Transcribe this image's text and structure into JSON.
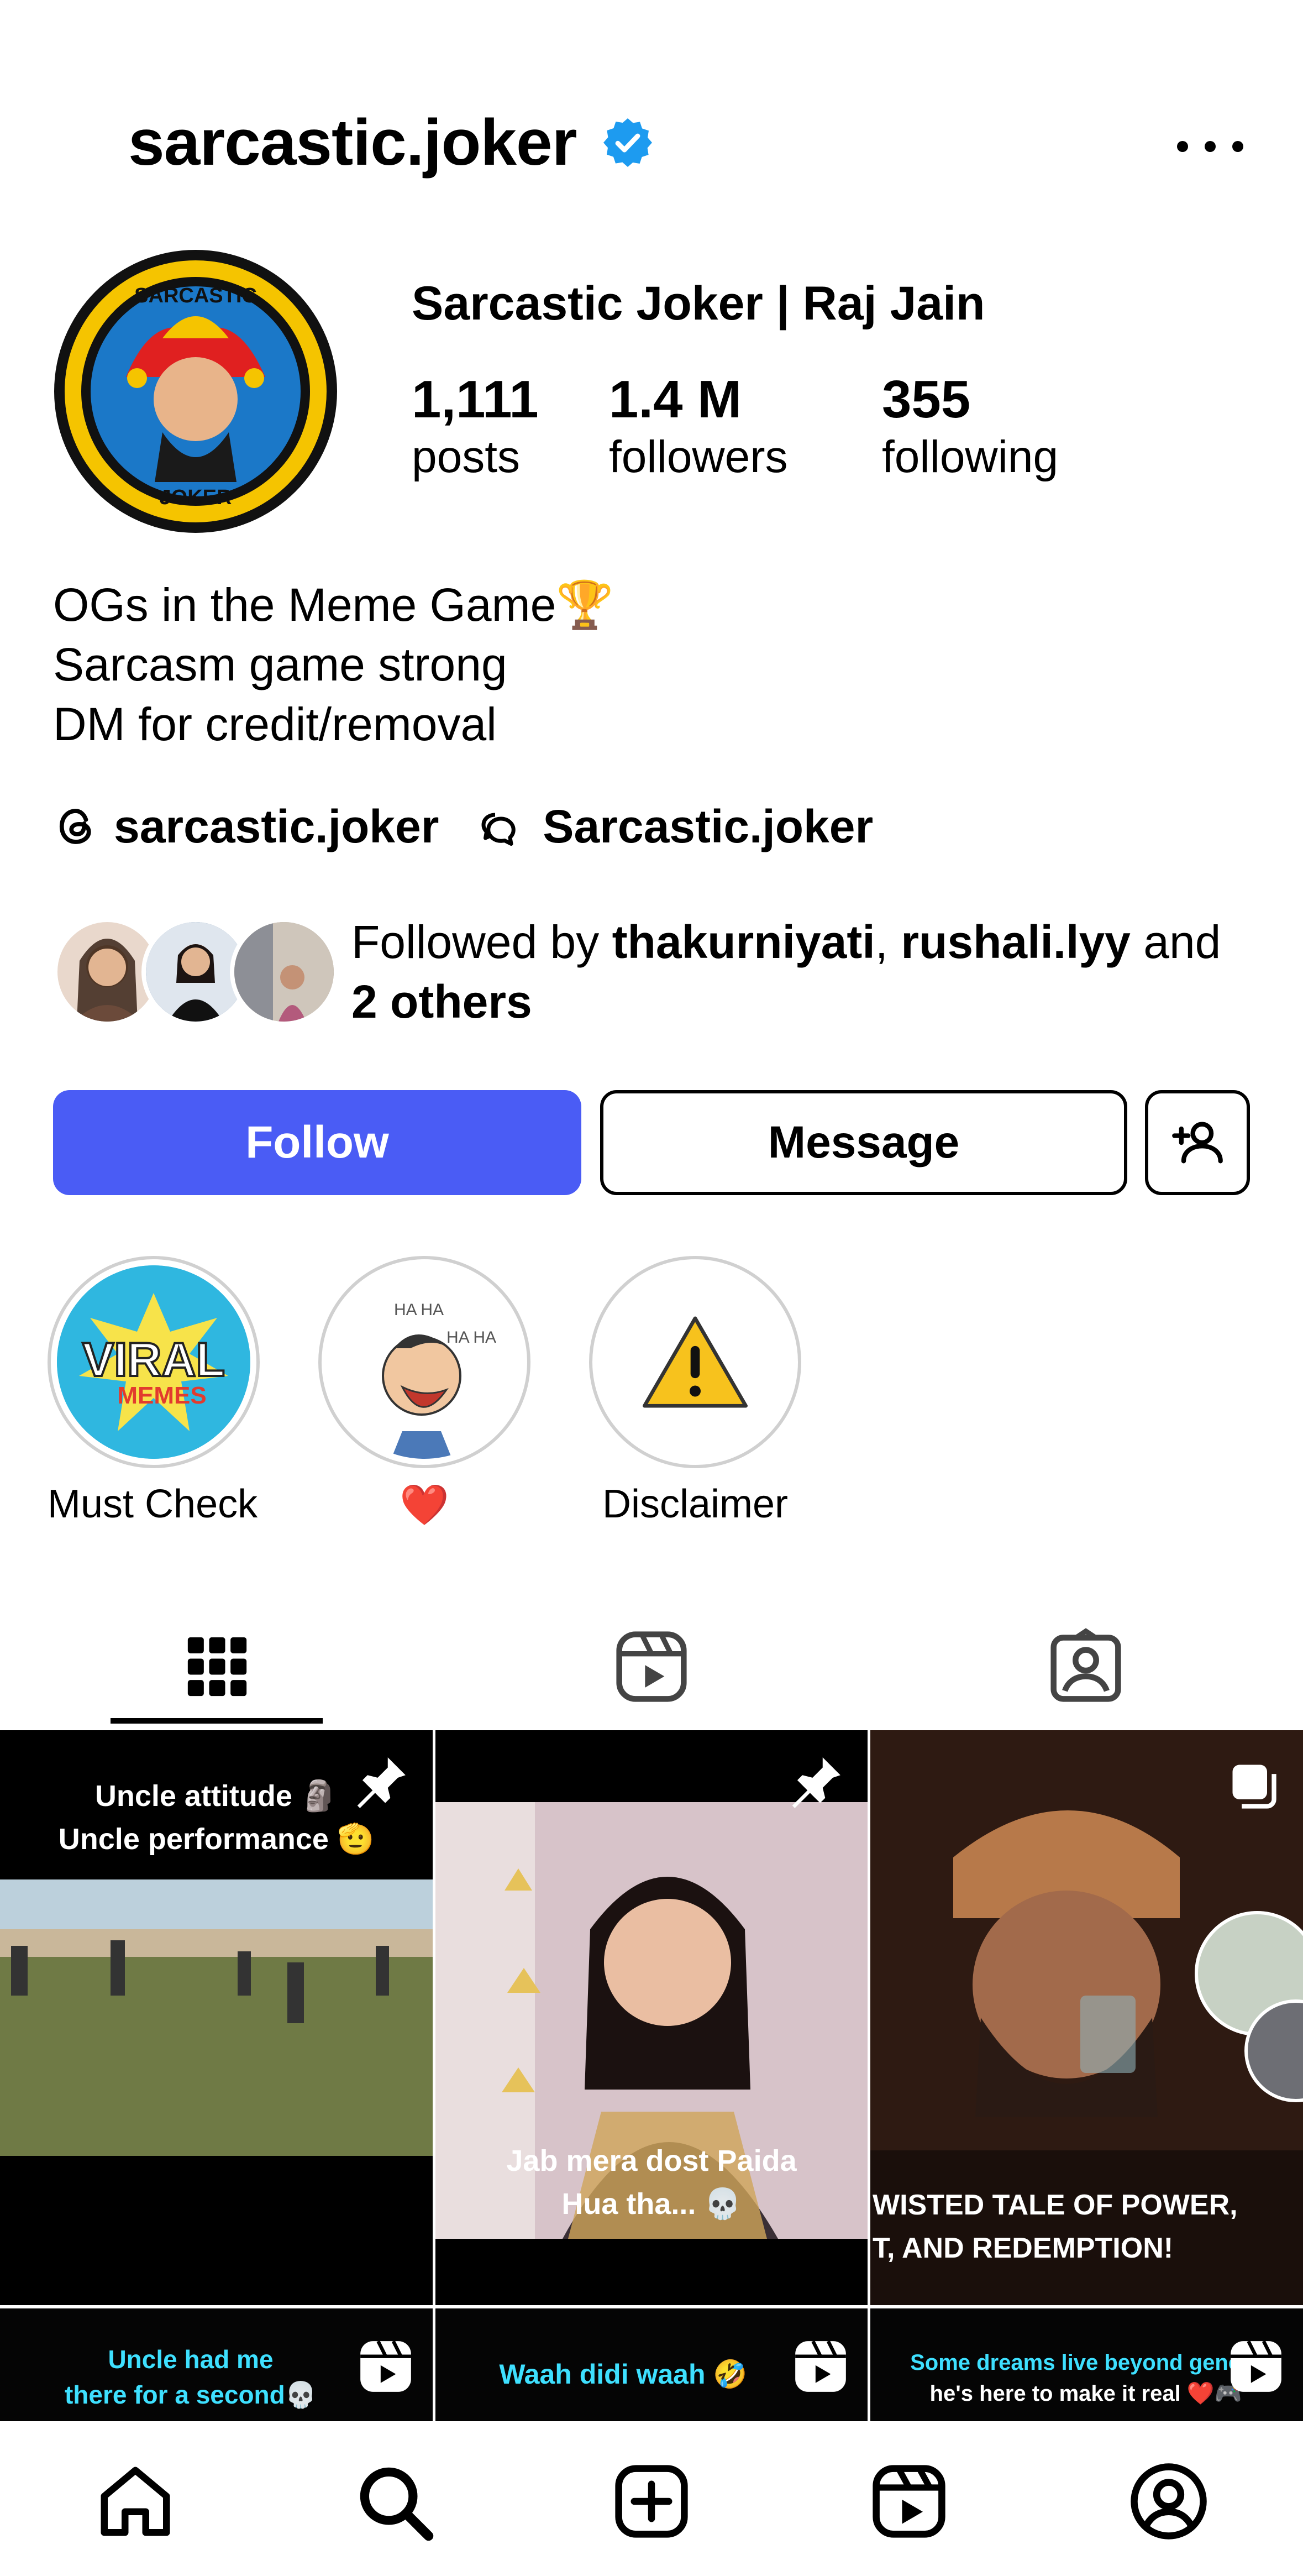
{
  "header": {
    "username": "sarcastic.joker"
  },
  "profile": {
    "display_name": "Sarcastic Joker | Raj Jain",
    "avatar_text_top": "SARCASTIC",
    "avatar_text_bottom": "JOKER",
    "stats": [
      {
        "value": "1,111",
        "label": "posts"
      },
      {
        "value": "1.4 M",
        "label": "followers"
      },
      {
        "value": "355",
        "label": "following"
      }
    ],
    "bio": [
      "OGs in the Meme Game🏆",
      "Sarcasm game strong",
      "DM for credit/removal"
    ],
    "links": {
      "threads": "sarcastic.joker",
      "handle2": "Sarcastic.joker"
    },
    "followed_by": {
      "prefix": "Followed by ",
      "user1": "thakurniyati",
      "sep": ", ",
      "user2": "rushali.lyy",
      "suffix": " and",
      "others": "2 others"
    }
  },
  "actions": {
    "follow": "Follow",
    "message": "Message"
  },
  "highlights": [
    {
      "label": "Must Check...",
      "art_text_1": "VIRAL",
      "art_text_2": "MEMES"
    },
    {
      "label": "❤️",
      "art_text_1": "HA HA"
    },
    {
      "label": "Disclaimer"
    }
  ],
  "posts": [
    {
      "caption_1": "Uncle attitude 🗿",
      "caption_2": "Uncle performance 🫡"
    },
    {
      "caption_1": "Jab mera dost Paida",
      "caption_2": "Hua tha... 💀"
    },
    {
      "caption_1": "WISTED TALE OF POWER,",
      "caption_2": "T, AND REDEMPTION!"
    },
    {
      "caption_1": "Uncle had me",
      "caption_2": "there for a second💀"
    },
    {
      "caption_1": "Waah didi waah 🤣"
    },
    {
      "caption_1": "Some dreams live beyond genera",
      "caption_2": "he's here to make it real ❤️🎮"
    }
  ],
  "colors": {
    "follow_button": "#4a5cf5",
    "verified": "#1d9bf0",
    "caption_highlight": "#3ee0ff"
  }
}
